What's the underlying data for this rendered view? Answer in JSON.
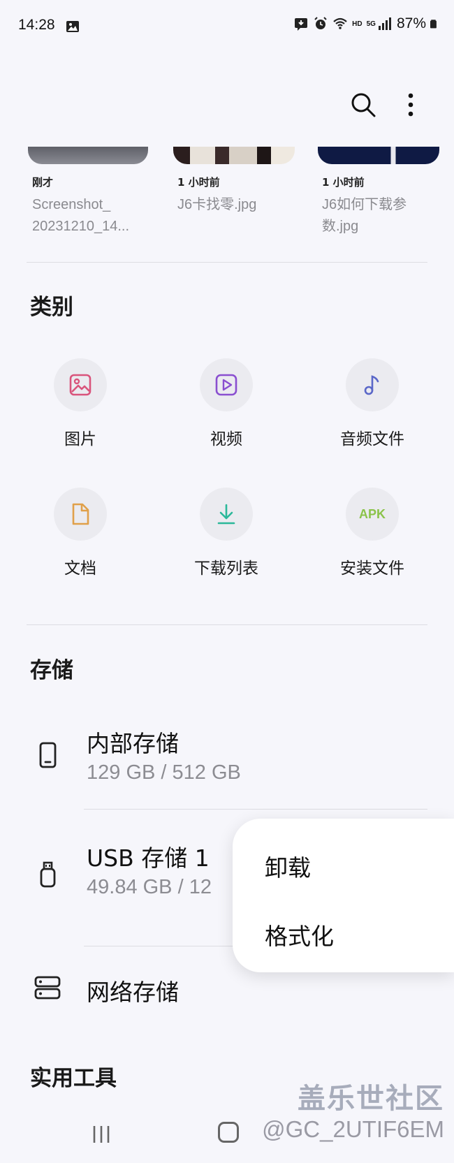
{
  "status": {
    "time": "14:28",
    "network": "HD",
    "network_gen": "5G",
    "battery": "87%"
  },
  "toolbar": {
    "search_icon": "search-icon",
    "more_icon": "more-vert-icon"
  },
  "recent": [
    {
      "time": "刚才",
      "name": "Screenshot_\n20231210_14..."
    },
    {
      "time": "1 小时前",
      "name": "J6卡找零.jpg"
    },
    {
      "time": "1 小时前",
      "name": "J6如何下载参\n数.jpg"
    }
  ],
  "categories": {
    "title": "类别",
    "items": [
      {
        "label": "图片",
        "icon": "image-icon",
        "color": "#d9547c"
      },
      {
        "label": "视频",
        "icon": "video-icon",
        "color": "#8a4fd0"
      },
      {
        "label": "音频文件",
        "icon": "music-icon",
        "color": "#5a67c8"
      },
      {
        "label": "文档",
        "icon": "document-icon",
        "color": "#e0a04a"
      },
      {
        "label": "下载列表",
        "icon": "download-icon",
        "color": "#2bb89a"
      },
      {
        "label": "安装文件",
        "icon": "apk-icon",
        "color": "#8bc34a",
        "badge": "APK"
      }
    ]
  },
  "storage": {
    "title": "存储",
    "internal": {
      "title": "内部存储",
      "usage": "129 GB / 512 GB"
    },
    "usb": {
      "title": "USB 存储 1",
      "usage": "49.84 GB / 12"
    },
    "network": {
      "title": "网络存储"
    }
  },
  "utilities": {
    "title": "实用工具"
  },
  "popup_menu": {
    "items": [
      "卸载",
      "格式化"
    ]
  },
  "watermark": {
    "line1": "盖乐世社区",
    "line2": "@GC_2UTIF6EM"
  }
}
